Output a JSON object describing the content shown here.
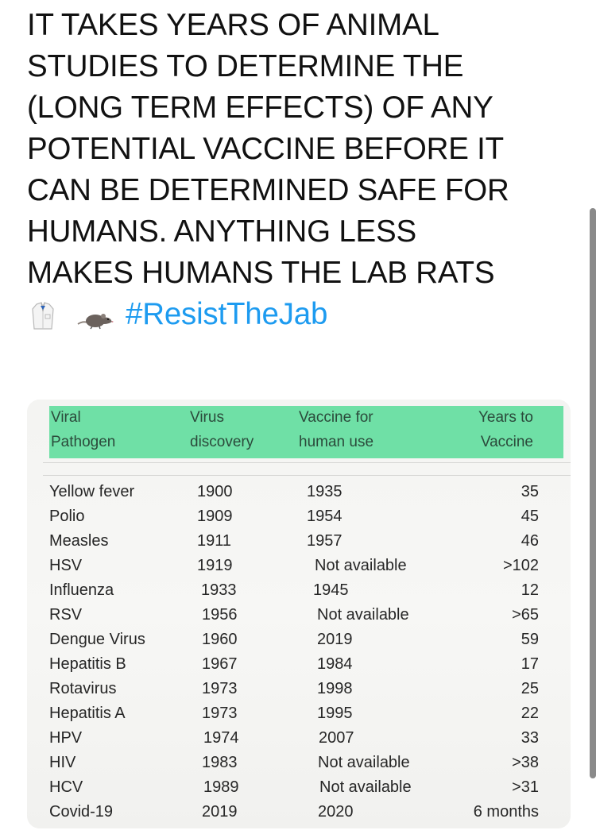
{
  "tweet": {
    "lines": [
      "IT TAKES YEARS OF ANIMAL",
      "STUDIES TO DETERMINE THE",
      "(LONG TERM EFFECTS) OF ANY",
      "POTENTIAL VACCINE BEFORE IT",
      "CAN BE DETERMINED SAFE FOR",
      "HUMANS. ANYTHING LESS",
      "MAKES HUMANS THE LAB RATS"
    ],
    "emojis": [
      "lab-coat",
      "rat"
    ],
    "hashtag": "#ResistTheJab",
    "colors": {
      "text": "#111111",
      "hashtag": "#1d9bf0",
      "table_header_highlight": "#6fe0a6"
    }
  },
  "table": {
    "headers": [
      "Viral\nPathogen",
      "Virus\ndiscovery",
      "Vaccine for\nhuman use",
      "Years to\nVaccine"
    ],
    "rows": [
      [
        "Yellow fever",
        "1900",
        "1935",
        "35"
      ],
      [
        "Polio",
        "1909",
        "1954",
        "45"
      ],
      [
        "Measles",
        "1911",
        "1957",
        "46"
      ],
      [
        "HSV",
        "1919",
        "Not available",
        ">102"
      ],
      [
        "Influenza",
        "1933",
        "1945",
        "12"
      ],
      [
        "RSV",
        "1956",
        "Not available",
        ">65"
      ],
      [
        "Dengue Virus",
        "1960",
        "2019",
        "59"
      ],
      [
        "Hepatitis B",
        "1967",
        "1984",
        "17"
      ],
      [
        "Rotavirus",
        "1973",
        "1998",
        "25"
      ],
      [
        "Hepatitis A",
        "1973",
        "1995",
        "22"
      ],
      [
        "HPV",
        "1974",
        "2007",
        "33"
      ],
      [
        "HIV",
        "1983",
        "Not available",
        ">38"
      ],
      [
        "HCV",
        "1989",
        "Not available",
        ">31"
      ],
      [
        "Covid-19",
        "2019",
        "2020",
        "6 months"
      ]
    ]
  }
}
